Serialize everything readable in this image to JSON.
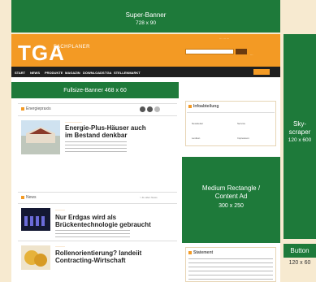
{
  "ads": {
    "super_banner": {
      "label": "Super-Banner",
      "size": "728 x 90"
    },
    "fullsize_banner": {
      "label": "Fullsize-Banner 468 x 60"
    },
    "skyscraper": {
      "label1": "Sky-",
      "label2": "scraper",
      "size": "120 x 600"
    },
    "medium_rectangle": {
      "label1": "Medium Rectangle /",
      "label2": "Content Ad",
      "size": "300 x 250"
    },
    "button": {
      "label": "Button",
      "size": "120 x 60"
    }
  },
  "header": {
    "logo": "TGA",
    "logo_sub": "FACHPLANER"
  },
  "nav": {
    "items": [
      "START",
      "NEWS",
      "PRODUKTE",
      "MAGAZIN",
      "DOWNLOADS",
      "TGA",
      "STELLENMARKT"
    ]
  },
  "left": {
    "featured_section": "Energiepraxis",
    "featured_headline_1": "Energie-Plus-Häuser auch",
    "featured_headline_2": "im Bestand denkbar",
    "news_section": "News",
    "news_link": "> Zu allen News",
    "news1_headline_1": "Nur Erdgas wird als",
    "news1_headline_2": "Brückentechnologie gebraucht",
    "news2_headline_1": "Rollenorientierung? landeiit",
    "news2_headline_2": "Contracting-Wirtschaft"
  },
  "right": {
    "infobox_title": "Infoabteilung",
    "infobox_items": [
      "Newsletter",
      "Service",
      "Lexikon",
      "Impressum"
    ],
    "bottom_box_title": "Statement"
  },
  "colors": {
    "brand_orange": "#f39a24",
    "ad_green": "#1e7a3a",
    "nav_dark": "#1f1f1f",
    "background": "#f7ead0"
  }
}
